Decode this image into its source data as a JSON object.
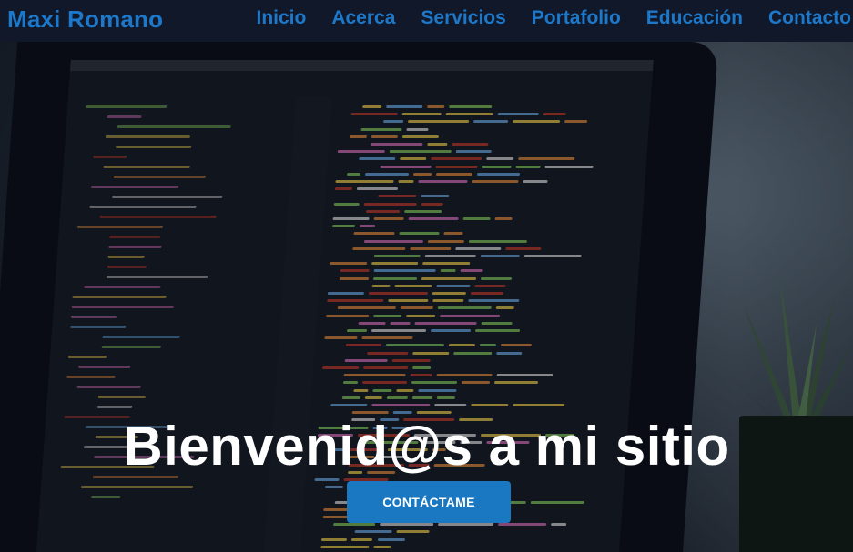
{
  "navbar": {
    "brand": "Maxi Romano",
    "links": [
      {
        "label": "Inicio"
      },
      {
        "label": "Acerca"
      },
      {
        "label": "Servicios"
      },
      {
        "label": "Portafolio"
      },
      {
        "label": "Educación"
      },
      {
        "label": "Contacto"
      }
    ]
  },
  "hero": {
    "title": "Bienvenid@s a mi sitio",
    "cta_label": "CONTÁCTAME"
  },
  "colors": {
    "brand": "#1d78c9",
    "navbar_bg": "#10182a",
    "cta_bg": "#1a78c2",
    "title_text": "#ffffff"
  }
}
